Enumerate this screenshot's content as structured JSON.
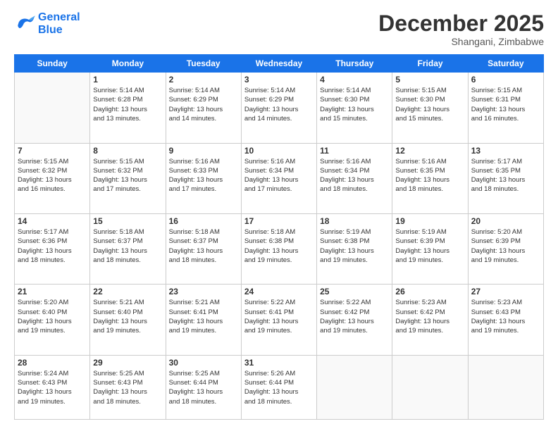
{
  "header": {
    "logo": {
      "line1": "General",
      "line2": "Blue"
    },
    "title": "December 2025",
    "subtitle": "Shangani, Zimbabwe"
  },
  "calendar": {
    "days_of_week": [
      "Sunday",
      "Monday",
      "Tuesday",
      "Wednesday",
      "Thursday",
      "Friday",
      "Saturday"
    ],
    "weeks": [
      [
        {
          "day": "",
          "info": ""
        },
        {
          "day": "1",
          "info": "Sunrise: 5:14 AM\nSunset: 6:28 PM\nDaylight: 13 hours\nand 13 minutes."
        },
        {
          "day": "2",
          "info": "Sunrise: 5:14 AM\nSunset: 6:29 PM\nDaylight: 13 hours\nand 14 minutes."
        },
        {
          "day": "3",
          "info": "Sunrise: 5:14 AM\nSunset: 6:29 PM\nDaylight: 13 hours\nand 14 minutes."
        },
        {
          "day": "4",
          "info": "Sunrise: 5:14 AM\nSunset: 6:30 PM\nDaylight: 13 hours\nand 15 minutes."
        },
        {
          "day": "5",
          "info": "Sunrise: 5:15 AM\nSunset: 6:30 PM\nDaylight: 13 hours\nand 15 minutes."
        },
        {
          "day": "6",
          "info": "Sunrise: 5:15 AM\nSunset: 6:31 PM\nDaylight: 13 hours\nand 16 minutes."
        }
      ],
      [
        {
          "day": "7",
          "info": "Sunrise: 5:15 AM\nSunset: 6:32 PM\nDaylight: 13 hours\nand 16 minutes."
        },
        {
          "day": "8",
          "info": "Sunrise: 5:15 AM\nSunset: 6:32 PM\nDaylight: 13 hours\nand 17 minutes."
        },
        {
          "day": "9",
          "info": "Sunrise: 5:16 AM\nSunset: 6:33 PM\nDaylight: 13 hours\nand 17 minutes."
        },
        {
          "day": "10",
          "info": "Sunrise: 5:16 AM\nSunset: 6:34 PM\nDaylight: 13 hours\nand 17 minutes."
        },
        {
          "day": "11",
          "info": "Sunrise: 5:16 AM\nSunset: 6:34 PM\nDaylight: 13 hours\nand 18 minutes."
        },
        {
          "day": "12",
          "info": "Sunrise: 5:16 AM\nSunset: 6:35 PM\nDaylight: 13 hours\nand 18 minutes."
        },
        {
          "day": "13",
          "info": "Sunrise: 5:17 AM\nSunset: 6:35 PM\nDaylight: 13 hours\nand 18 minutes."
        }
      ],
      [
        {
          "day": "14",
          "info": "Sunrise: 5:17 AM\nSunset: 6:36 PM\nDaylight: 13 hours\nand 18 minutes."
        },
        {
          "day": "15",
          "info": "Sunrise: 5:18 AM\nSunset: 6:37 PM\nDaylight: 13 hours\nand 18 minutes."
        },
        {
          "day": "16",
          "info": "Sunrise: 5:18 AM\nSunset: 6:37 PM\nDaylight: 13 hours\nand 18 minutes."
        },
        {
          "day": "17",
          "info": "Sunrise: 5:18 AM\nSunset: 6:38 PM\nDaylight: 13 hours\nand 19 minutes."
        },
        {
          "day": "18",
          "info": "Sunrise: 5:19 AM\nSunset: 6:38 PM\nDaylight: 13 hours\nand 19 minutes."
        },
        {
          "day": "19",
          "info": "Sunrise: 5:19 AM\nSunset: 6:39 PM\nDaylight: 13 hours\nand 19 minutes."
        },
        {
          "day": "20",
          "info": "Sunrise: 5:20 AM\nSunset: 6:39 PM\nDaylight: 13 hours\nand 19 minutes."
        }
      ],
      [
        {
          "day": "21",
          "info": "Sunrise: 5:20 AM\nSunset: 6:40 PM\nDaylight: 13 hours\nand 19 minutes."
        },
        {
          "day": "22",
          "info": "Sunrise: 5:21 AM\nSunset: 6:40 PM\nDaylight: 13 hours\nand 19 minutes."
        },
        {
          "day": "23",
          "info": "Sunrise: 5:21 AM\nSunset: 6:41 PM\nDaylight: 13 hours\nand 19 minutes."
        },
        {
          "day": "24",
          "info": "Sunrise: 5:22 AM\nSunset: 6:41 PM\nDaylight: 13 hours\nand 19 minutes."
        },
        {
          "day": "25",
          "info": "Sunrise: 5:22 AM\nSunset: 6:42 PM\nDaylight: 13 hours\nand 19 minutes."
        },
        {
          "day": "26",
          "info": "Sunrise: 5:23 AM\nSunset: 6:42 PM\nDaylight: 13 hours\nand 19 minutes."
        },
        {
          "day": "27",
          "info": "Sunrise: 5:23 AM\nSunset: 6:43 PM\nDaylight: 13 hours\nand 19 minutes."
        }
      ],
      [
        {
          "day": "28",
          "info": "Sunrise: 5:24 AM\nSunset: 6:43 PM\nDaylight: 13 hours\nand 19 minutes."
        },
        {
          "day": "29",
          "info": "Sunrise: 5:25 AM\nSunset: 6:43 PM\nDaylight: 13 hours\nand 18 minutes."
        },
        {
          "day": "30",
          "info": "Sunrise: 5:25 AM\nSunset: 6:44 PM\nDaylight: 13 hours\nand 18 minutes."
        },
        {
          "day": "31",
          "info": "Sunrise: 5:26 AM\nSunset: 6:44 PM\nDaylight: 13 hours\nand 18 minutes."
        },
        {
          "day": "",
          "info": ""
        },
        {
          "day": "",
          "info": ""
        },
        {
          "day": "",
          "info": ""
        }
      ]
    ]
  }
}
